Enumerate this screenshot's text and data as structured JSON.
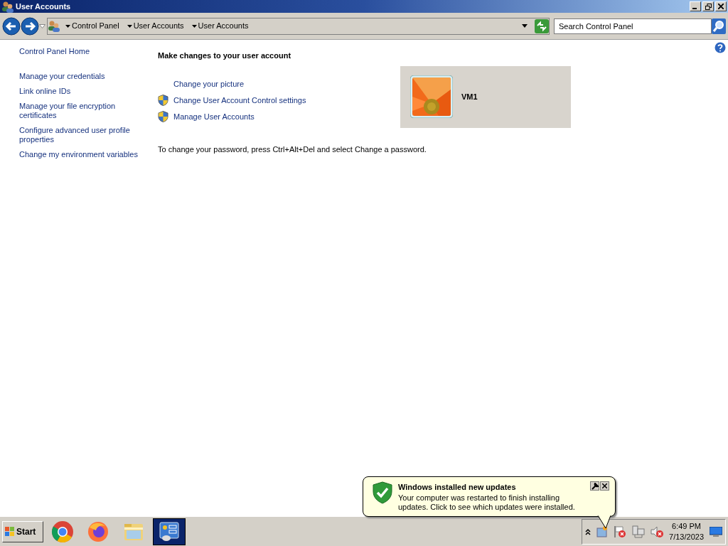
{
  "window": {
    "title": "User Accounts"
  },
  "address_bar": {
    "breadcrumbs": [
      "Control Panel",
      "User Accounts",
      "User Accounts"
    ]
  },
  "search": {
    "placeholder": "Search Control Panel"
  },
  "sidebar": {
    "links": [
      {
        "label": "Control Panel Home",
        "kind": "home"
      },
      {
        "label": "Manage your credentials",
        "kind": "task"
      },
      {
        "label": "Link online IDs",
        "kind": "task"
      },
      {
        "label": "Manage your file encryption certificates",
        "kind": "task"
      },
      {
        "label": "Configure advanced user profile properties",
        "kind": "task"
      },
      {
        "label": "Change my environment variables",
        "kind": "task"
      }
    ]
  },
  "main": {
    "heading": "Make changes to your user account",
    "tasks": [
      {
        "label": "Change your picture",
        "shield": false
      },
      {
        "label": "Change User Account Control settings",
        "shield": true
      },
      {
        "label": "Manage User Accounts",
        "shield": true
      }
    ],
    "note": "To change your password, press Ctrl+Alt+Del and select Change a password."
  },
  "account": {
    "name": "VM1"
  },
  "notification": {
    "title": "Windows installed new updates",
    "text": "Your computer was restarted to finish installing updates. Click to see which updates were installed."
  },
  "taskbar": {
    "start": "Start",
    "apps": [
      {
        "kind": "chrome",
        "selected": false
      },
      {
        "kind": "firefox",
        "selected": false
      },
      {
        "kind": "explorer",
        "selected": false
      },
      {
        "kind": "control-panel",
        "selected": true
      }
    ],
    "clock": {
      "time": "6:49 PM",
      "date": "7/13/2023"
    }
  }
}
